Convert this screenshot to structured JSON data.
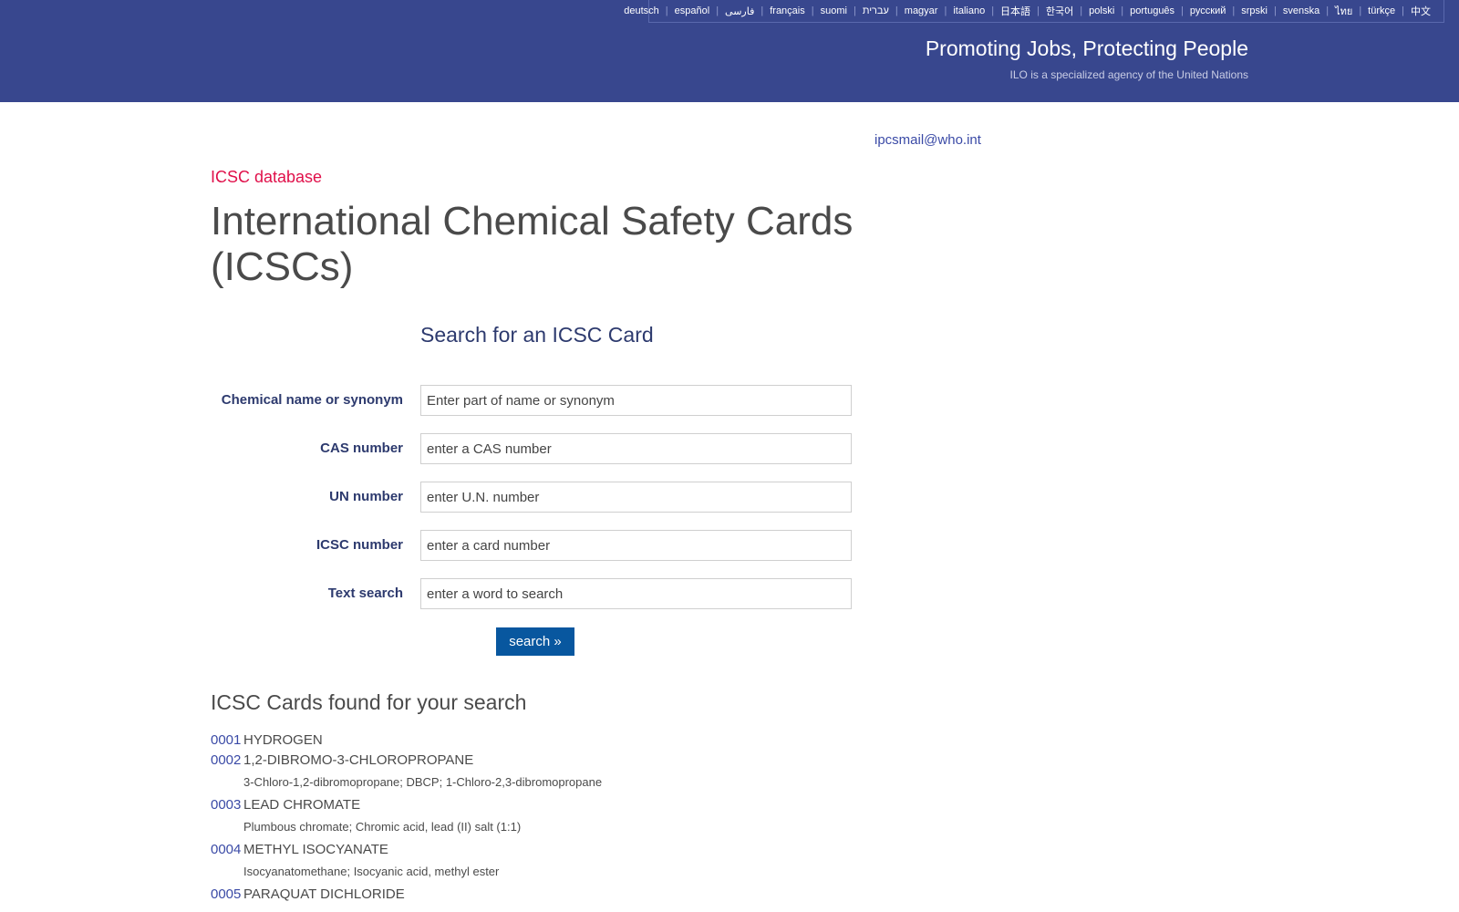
{
  "header": {
    "languages": [
      "deutsch",
      "español",
      "فارسی",
      "français",
      "suomi",
      "עברית",
      "magyar",
      "italiano",
      "日本語",
      "한국어",
      "polski",
      "português",
      "русский",
      "srpski",
      "svenska",
      "ไทย",
      "türkçe",
      "中文"
    ],
    "tagline": "Promoting Jobs, Protecting People",
    "subtagline": "ILO is a specialized agency of the United Nations"
  },
  "contact_email": "ipcsmail@who.int",
  "section_label": "ICSC database",
  "page_title": "International Chemical Safety Cards (ICSCs)",
  "search": {
    "heading": "Search for an ICSC Card",
    "fields": [
      {
        "label": "Chemical name or synonym",
        "placeholder": "Enter part of name or synonym",
        "value": ""
      },
      {
        "label": "CAS number",
        "placeholder": "enter a CAS number",
        "value": ""
      },
      {
        "label": "UN number",
        "placeholder": "enter U.N. number",
        "value": ""
      },
      {
        "label": "ICSC number",
        "placeholder": "enter a card number",
        "value": ""
      },
      {
        "label": "Text search",
        "placeholder": "enter a word to search",
        "value": ""
      }
    ],
    "button_label": "search »"
  },
  "results": {
    "heading": "ICSC Cards found for your search",
    "items": [
      {
        "number": "0001",
        "name": "HYDROGEN",
        "synonyms": ""
      },
      {
        "number": "0002",
        "name": "1,2-DIBROMO-3-CHLOROPROPANE",
        "synonyms": "3-Chloro-1,2-dibromopropane; DBCP; 1-Chloro-2,3-dibromopropane"
      },
      {
        "number": "0003",
        "name": "LEAD CHROMATE",
        "synonyms": "Plumbous chromate; Chromic acid, lead (II) salt (1:1)"
      },
      {
        "number": "0004",
        "name": "METHYL ISOCYANATE",
        "synonyms": "Isocyanatomethane; Isocyanic acid, methyl ester"
      },
      {
        "number": "0005",
        "name": "PARAQUAT DICHLORIDE",
        "synonyms": ""
      }
    ]
  },
  "colors": {
    "header_bg": "#38478e",
    "accent_red": "#e0104a",
    "link_blue": "#3a4aa6",
    "button_bg": "#08579f"
  }
}
